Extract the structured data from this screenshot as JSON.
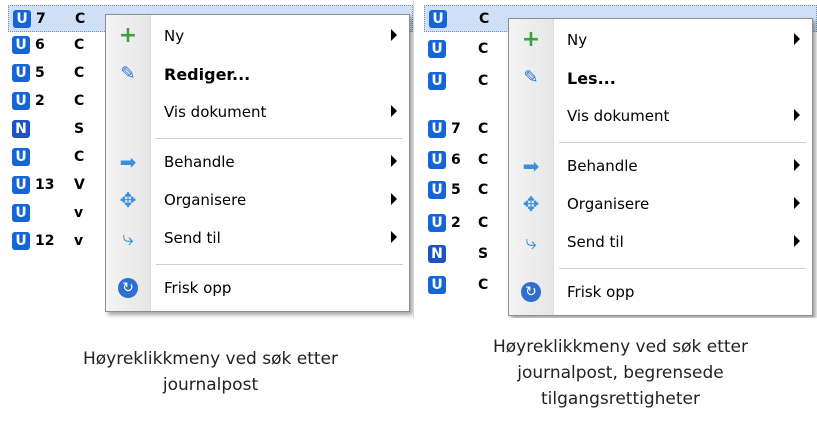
{
  "left": {
    "rows": [
      {
        "num": "7",
        "ch": "C",
        "icon": "user-badge-icon",
        "selected": true
      },
      {
        "num": "6",
        "ch": "C",
        "icon": "user-badge-icon"
      },
      {
        "num": "5",
        "ch": "C",
        "icon": "user-badge-icon"
      },
      {
        "num": "2",
        "ch": "C",
        "icon": "user-badge-icon"
      },
      {
        "num": "",
        "ch": "S",
        "icon": "note-locked-icon"
      },
      {
        "num": "",
        "ch": "C",
        "icon": "user-locked-icon"
      },
      {
        "num": "13",
        "ch": "V",
        "icon": "user-badge-icon"
      },
      {
        "num": "",
        "ch": "v",
        "icon": "user-locked-icon"
      },
      {
        "num": "12",
        "ch": "v",
        "icon": "user-badge-icon"
      }
    ],
    "menu": {
      "items": [
        {
          "label": "Ny",
          "icon": "plus-icon",
          "arrow": true,
          "bold": false
        },
        {
          "label": "Rediger...",
          "icon": "pencil-icon",
          "arrow": false,
          "bold": true
        },
        {
          "label": "Vis dokument",
          "icon": "",
          "arrow": true,
          "bold": false
        },
        {
          "label": "Behandle",
          "icon": "process-arrow-icon",
          "arrow": true,
          "bold": false
        },
        {
          "label": "Organisere",
          "icon": "move-icon",
          "arrow": true,
          "bold": false
        },
        {
          "label": "Send til",
          "icon": "send-icon",
          "arrow": true,
          "bold": false
        },
        {
          "label": "Frisk opp",
          "icon": "refresh-icon",
          "arrow": false,
          "bold": false
        }
      ]
    },
    "caption_line1": "Høyreklikkmeny ved søk etter",
    "caption_line2": "journalpost"
  },
  "right": {
    "rows": [
      {
        "num": "",
        "ch": "C",
        "icon": "user-locked-icon",
        "selected": true
      },
      {
        "num": "",
        "ch": "C",
        "icon": "user-locked-icon"
      },
      {
        "num": "",
        "ch": "C",
        "icon": "user-locked-icon"
      },
      {
        "num": "7",
        "ch": "C",
        "icon": "user-badge-icon"
      },
      {
        "num": "6",
        "ch": "C",
        "icon": "user-badge-icon"
      },
      {
        "num": "5",
        "ch": "C",
        "icon": "user-badge-icon"
      },
      {
        "num": "2",
        "ch": "C",
        "icon": "user-badge-icon"
      },
      {
        "num": "",
        "ch": "S",
        "icon": "note-locked-icon"
      },
      {
        "num": "",
        "ch": "C",
        "icon": "user-locked-icon"
      }
    ],
    "menu": {
      "items": [
        {
          "label": "Ny",
          "icon": "plus-icon",
          "arrow": true,
          "bold": false
        },
        {
          "label": "Les...",
          "icon": "pencil-icon",
          "arrow": false,
          "bold": true
        },
        {
          "label": "Vis dokument",
          "icon": "",
          "arrow": true,
          "bold": false
        },
        {
          "label": "Behandle",
          "icon": "process-arrow-icon",
          "arrow": true,
          "bold": false
        },
        {
          "label": "Organisere",
          "icon": "move-icon",
          "arrow": true,
          "bold": false
        },
        {
          "label": "Send til",
          "icon": "send-icon",
          "arrow": true,
          "bold": false
        },
        {
          "label": "Frisk opp",
          "icon": "refresh-icon",
          "arrow": false,
          "bold": false
        }
      ]
    },
    "caption_line1": "Høyreklikkmeny ved søk etter",
    "caption_line2": "journalpost, begrensede",
    "caption_line3": "tilgangsrettigheter"
  },
  "badge_letters": {
    "user": "U",
    "note": "N"
  },
  "colors": {
    "badge": "#1665d8",
    "selection": "#cfe0f7",
    "menu_border": "#8f8f8f"
  }
}
